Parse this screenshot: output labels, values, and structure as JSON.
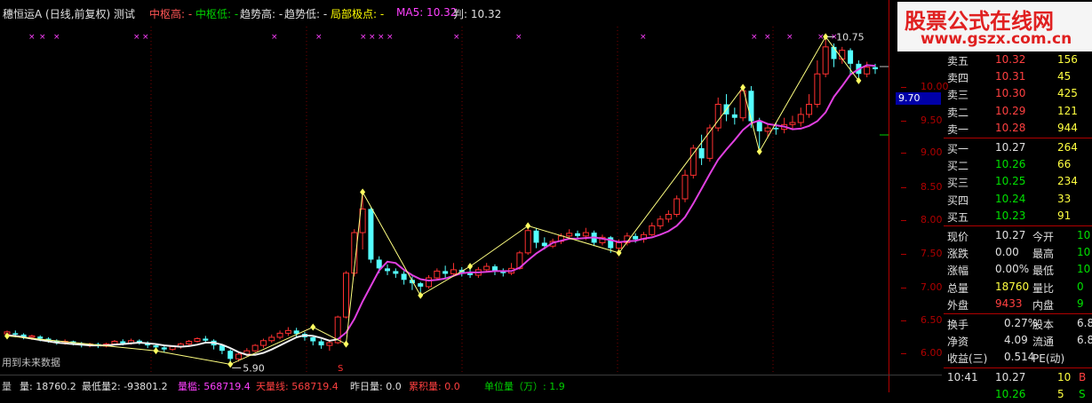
{
  "header": {
    "title": "穗恒运A (日线,前复权) 测试",
    "zs_high": "中枢高: -",
    "zs_low": "中枢低: -",
    "trend_high": "趋势高: -",
    "trend_low": "趋势低: -",
    "local_peak": "局部极点: -",
    "ma5": "MA5: 10.32",
    "judge": "判: 10.32",
    "colors": {
      "white": "#c0c0c0",
      "red": "#ff5555",
      "green": "#00d000",
      "magenta": "#ff40ff",
      "yellow": "#ffff00",
      "title": "#e0e0e0"
    }
  },
  "watermark": {
    "line1": "股票公式在线网",
    "line2": "www.gszx.com.cn"
  },
  "price_axis": {
    "ticks": [
      "10.00",
      "9.50",
      "9.00",
      "8.50",
      "8.00",
      "7.50",
      "7.00",
      "6.50",
      "6.00"
    ],
    "current": "9.70"
  },
  "annotations": {
    "high": "10.75",
    "low": "5.90",
    "footnote": "用到未来数据"
  },
  "bottom": {
    "vol": "量: 18760.2",
    "minvol": "最低量2: -93801.2",
    "volthresh": "量槛: 568719.4",
    "dayvol": "天量线: 568719.4",
    "prevvol": "昨日量: 0.0",
    "accvol": "累积量: 0.0",
    "unitvol": "单位量（万）: 1.9",
    "prefix": "量"
  },
  "orderbook": {
    "asks": [
      {
        "label": "卖五",
        "price": "10.32",
        "vol": "156"
      },
      {
        "label": "卖四",
        "price": "10.31",
        "vol": "45"
      },
      {
        "label": "卖三",
        "price": "10.30",
        "vol": "425"
      },
      {
        "label": "卖二",
        "price": "10.29",
        "vol": "121"
      },
      {
        "label": "卖一",
        "price": "10.28",
        "vol": "944"
      }
    ],
    "bids": [
      {
        "label": "买一",
        "price": "10.27",
        "vol": "264"
      },
      {
        "label": "买二",
        "price": "10.26",
        "vol": "66"
      },
      {
        "label": "买三",
        "price": "10.25",
        "vol": "234"
      },
      {
        "label": "买四",
        "price": "10.24",
        "vol": "33"
      },
      {
        "label": "买五",
        "price": "10.23",
        "vol": "91"
      }
    ]
  },
  "quote": [
    {
      "l1": "现价",
      "v1": "10.27",
      "l2": "今开",
      "v2": "10"
    },
    {
      "l1": "涨跌",
      "v1": "0.00",
      "l2": "最高",
      "v2": "10"
    },
    {
      "l1": "涨幅",
      "v1": "0.00%",
      "l2": "最低",
      "v2": "10"
    },
    {
      "l1": "总量",
      "v1": "18760",
      "l2": "量比",
      "v2": "0"
    },
    {
      "l1": "外盘",
      "v1": "9433",
      "l2": "内盘",
      "v2": "9"
    }
  ],
  "fund": [
    {
      "l1": "换手",
      "v1": "0.27%",
      "l2": "股本",
      "v2": "6.8"
    },
    {
      "l1": "净资",
      "v1": "4.09",
      "l2": "流通",
      "v2": "6.8"
    },
    {
      "l1": "收益(三)",
      "v1": "0.514",
      "l2": "PE(动)",
      "v2": ""
    }
  ],
  "ticks_tail": [
    {
      "time": "10:41",
      "price": "10.27",
      "vol": "10",
      "side": "B"
    },
    {
      "time": "",
      "price": "10.26",
      "vol": "5",
      "side": "S"
    }
  ],
  "chart_data": {
    "type": "candlestick",
    "ylim": [
      5.8,
      10.9
    ],
    "candles": [
      [
        6.35,
        6.38,
        6.3,
        6.4
      ],
      [
        6.36,
        6.34,
        6.3,
        6.4
      ],
      [
        6.34,
        6.3,
        6.27,
        6.36
      ],
      [
        6.3,
        6.32,
        6.26,
        6.34
      ],
      [
        6.31,
        6.28,
        6.24,
        6.33
      ],
      [
        6.28,
        6.25,
        6.22,
        6.3
      ],
      [
        6.25,
        6.22,
        6.19,
        6.27
      ],
      [
        6.22,
        6.24,
        6.19,
        6.27
      ],
      [
        6.24,
        6.21,
        6.18,
        6.25
      ],
      [
        6.21,
        6.18,
        6.15,
        6.23
      ],
      [
        6.18,
        6.2,
        6.15,
        6.22
      ],
      [
        6.2,
        6.17,
        6.14,
        6.22
      ],
      [
        6.17,
        6.2,
        6.15,
        6.22
      ],
      [
        6.2,
        6.24,
        6.18,
        6.26
      ],
      [
        6.24,
        6.21,
        6.18,
        6.27
      ],
      [
        6.21,
        6.25,
        6.19,
        6.28
      ],
      [
        6.25,
        6.22,
        6.19,
        6.27
      ],
      [
        6.22,
        6.18,
        6.14,
        6.24
      ],
      [
        6.18,
        6.15,
        6.1,
        6.2
      ],
      [
        6.15,
        6.12,
        6.08,
        6.18
      ],
      [
        6.12,
        6.16,
        6.1,
        6.18
      ],
      [
        6.16,
        6.2,
        6.13,
        6.22
      ],
      [
        6.2,
        6.24,
        6.18,
        6.26
      ],
      [
        6.24,
        6.28,
        6.22,
        6.3
      ],
      [
        6.28,
        6.25,
        6.22,
        6.32
      ],
      [
        6.25,
        6.18,
        6.12,
        6.27
      ],
      [
        6.18,
        6.1,
        6.05,
        6.2
      ],
      [
        6.1,
        5.98,
        5.9,
        6.12
      ],
      [
        5.98,
        6.05,
        5.94,
        6.08
      ],
      [
        6.05,
        6.1,
        6.02,
        6.14
      ],
      [
        6.1,
        6.18,
        6.08,
        6.2
      ],
      [
        6.18,
        6.25,
        6.14,
        6.28
      ],
      [
        6.25,
        6.3,
        6.22,
        6.34
      ],
      [
        6.3,
        6.36,
        6.27,
        6.4
      ],
      [
        6.36,
        6.4,
        6.32,
        6.45
      ],
      [
        6.4,
        6.35,
        6.3,
        6.44
      ],
      [
        6.35,
        6.3,
        6.25,
        6.38
      ],
      [
        6.3,
        6.24,
        6.18,
        6.33
      ],
      [
        6.24,
        6.18,
        6.13,
        6.27
      ],
      [
        6.18,
        6.22,
        6.1,
        6.25
      ],
      [
        6.22,
        6.6,
        6.2,
        6.62
      ],
      [
        6.6,
        7.25,
        6.58,
        7.28
      ],
      [
        7.25,
        7.85,
        7.2,
        7.9
      ],
      [
        7.85,
        8.2,
        7.6,
        8.45
      ],
      [
        8.2,
        7.45,
        7.4,
        8.22
      ],
      [
        7.45,
        7.32,
        7.25,
        7.5
      ],
      [
        7.32,
        7.28,
        7.22,
        7.38
      ],
      [
        7.28,
        7.24,
        7.18,
        7.32
      ],
      [
        7.24,
        7.15,
        7.08,
        7.28
      ],
      [
        7.15,
        7.1,
        7.0,
        7.2
      ],
      [
        7.1,
        7.05,
        6.92,
        7.12
      ],
      [
        7.05,
        7.18,
        7.02,
        7.22
      ],
      [
        7.18,
        7.28,
        7.14,
        7.32
      ],
      [
        7.28,
        7.24,
        7.18,
        7.36
      ],
      [
        7.24,
        7.3,
        7.2,
        7.4
      ],
      [
        7.3,
        7.26,
        7.2,
        7.34
      ],
      [
        7.26,
        7.22,
        7.18,
        7.32
      ],
      [
        7.22,
        7.3,
        7.18,
        7.34
      ],
      [
        7.3,
        7.35,
        7.26,
        7.4
      ],
      [
        7.35,
        7.28,
        7.22,
        7.38
      ],
      [
        7.28,
        7.25,
        7.2,
        7.32
      ],
      [
        7.25,
        7.32,
        7.22,
        7.4
      ],
      [
        7.32,
        7.55,
        7.3,
        7.58
      ],
      [
        7.55,
        7.88,
        7.52,
        7.95
      ],
      [
        7.88,
        7.7,
        7.62,
        7.92
      ],
      [
        7.7,
        7.65,
        7.6,
        7.78
      ],
      [
        7.65,
        7.72,
        7.62,
        7.76
      ],
      [
        7.72,
        7.8,
        7.68,
        7.84
      ],
      [
        7.8,
        7.84,
        7.75,
        7.9
      ],
      [
        7.84,
        7.8,
        7.75,
        7.88
      ],
      [
        7.8,
        7.85,
        7.74,
        7.92
      ],
      [
        7.85,
        7.7,
        7.65,
        7.88
      ],
      [
        7.7,
        7.78,
        7.66,
        7.82
      ],
      [
        7.78,
        7.62,
        7.55,
        7.8
      ],
      [
        7.62,
        7.7,
        7.56,
        7.75
      ],
      [
        7.7,
        7.8,
        7.66,
        7.85
      ],
      [
        7.8,
        7.75,
        7.7,
        7.84
      ],
      [
        7.75,
        7.82,
        7.7,
        7.86
      ],
      [
        7.82,
        7.95,
        7.8,
        8.0
      ],
      [
        7.95,
        8.05,
        7.9,
        8.1
      ],
      [
        8.05,
        8.12,
        8.0,
        8.18
      ],
      [
        8.12,
        8.35,
        8.08,
        8.4
      ],
      [
        8.35,
        8.7,
        8.3,
        8.78
      ],
      [
        8.7,
        9.1,
        8.65,
        9.15
      ],
      [
        9.1,
        8.95,
        8.85,
        9.3
      ],
      [
        8.95,
        9.4,
        8.9,
        9.45
      ],
      [
        9.4,
        9.75,
        9.35,
        9.85
      ],
      [
        9.75,
        9.6,
        9.5,
        9.9
      ],
      [
        9.6,
        9.55,
        9.45,
        9.7
      ],
      [
        9.55,
        9.95,
        9.5,
        10.0
      ],
      [
        9.95,
        9.5,
        9.4,
        10.02
      ],
      [
        9.5,
        9.35,
        9.05,
        9.55
      ],
      [
        9.35,
        9.4,
        9.25,
        9.45
      ],
      [
        9.4,
        9.38,
        9.3,
        9.48
      ],
      [
        9.38,
        9.45,
        9.32,
        9.55
      ],
      [
        9.45,
        9.48,
        9.38,
        9.58
      ],
      [
        9.48,
        9.6,
        9.42,
        9.7
      ],
      [
        9.6,
        9.75,
        9.55,
        9.9
      ],
      [
        9.75,
        10.2,
        9.7,
        10.4
      ],
      [
        10.2,
        10.6,
        10.15,
        10.75
      ],
      [
        10.6,
        10.42,
        10.3,
        10.65
      ],
      [
        10.42,
        10.55,
        10.35,
        10.6
      ],
      [
        10.55,
        10.35,
        10.2,
        10.58
      ],
      [
        10.35,
        10.2,
        10.1,
        10.4
      ],
      [
        10.2,
        10.3,
        10.15,
        10.38
      ],
      [
        10.3,
        10.27,
        10.2,
        10.35
      ]
    ],
    "ma5": [
      6.33,
      6.32,
      6.3,
      6.28,
      6.26,
      6.24,
      6.22,
      6.21,
      6.2,
      6.19,
      6.18,
      6.18,
      6.18,
      6.19,
      6.2,
      6.21,
      6.22,
      6.21,
      6.2,
      6.18,
      6.17,
      6.16,
      6.17,
      6.19,
      6.22,
      6.22,
      6.19,
      6.14,
      6.08,
      6.04,
      6.04,
      6.07,
      6.12,
      6.18,
      6.24,
      6.3,
      6.33,
      6.32,
      6.29,
      6.25,
      6.27,
      6.37,
      6.57,
      6.83,
      7.06,
      7.29,
      7.42,
      7.4,
      7.3,
      7.22,
      7.16,
      7.14,
      7.15,
      7.17,
      7.21,
      7.25,
      7.26,
      7.26,
      7.27,
      7.28,
      7.28,
      7.28,
      7.33,
      7.44,
      7.54,
      7.62,
      7.7,
      7.73,
      7.76,
      7.76,
      7.77,
      7.78,
      7.76,
      7.74,
      7.71,
      7.72,
      7.73,
      7.76,
      7.78,
      7.82,
      7.87,
      7.95,
      8.08,
      8.28,
      8.5,
      8.72,
      8.93,
      9.08,
      9.22,
      9.37,
      9.47,
      9.51,
      9.46,
      9.44,
      9.42,
      9.38,
      9.39,
      9.43,
      9.5,
      9.63,
      9.86,
      10.02,
      10.19,
      10.27,
      10.33,
      10.32
    ],
    "zigzag": [
      [
        0,
        6.32
      ],
      [
        18,
        6.1
      ],
      [
        27,
        5.9
      ],
      [
        37,
        6.45
      ],
      [
        41,
        6.2
      ],
      [
        43,
        8.45
      ],
      [
        50,
        6.92
      ],
      [
        56,
        7.35
      ],
      [
        63,
        7.95
      ],
      [
        74,
        7.55
      ],
      [
        89,
        10.0
      ],
      [
        91,
        9.05
      ],
      [
        99,
        10.75
      ],
      [
        103,
        10.1
      ]
    ]
  }
}
